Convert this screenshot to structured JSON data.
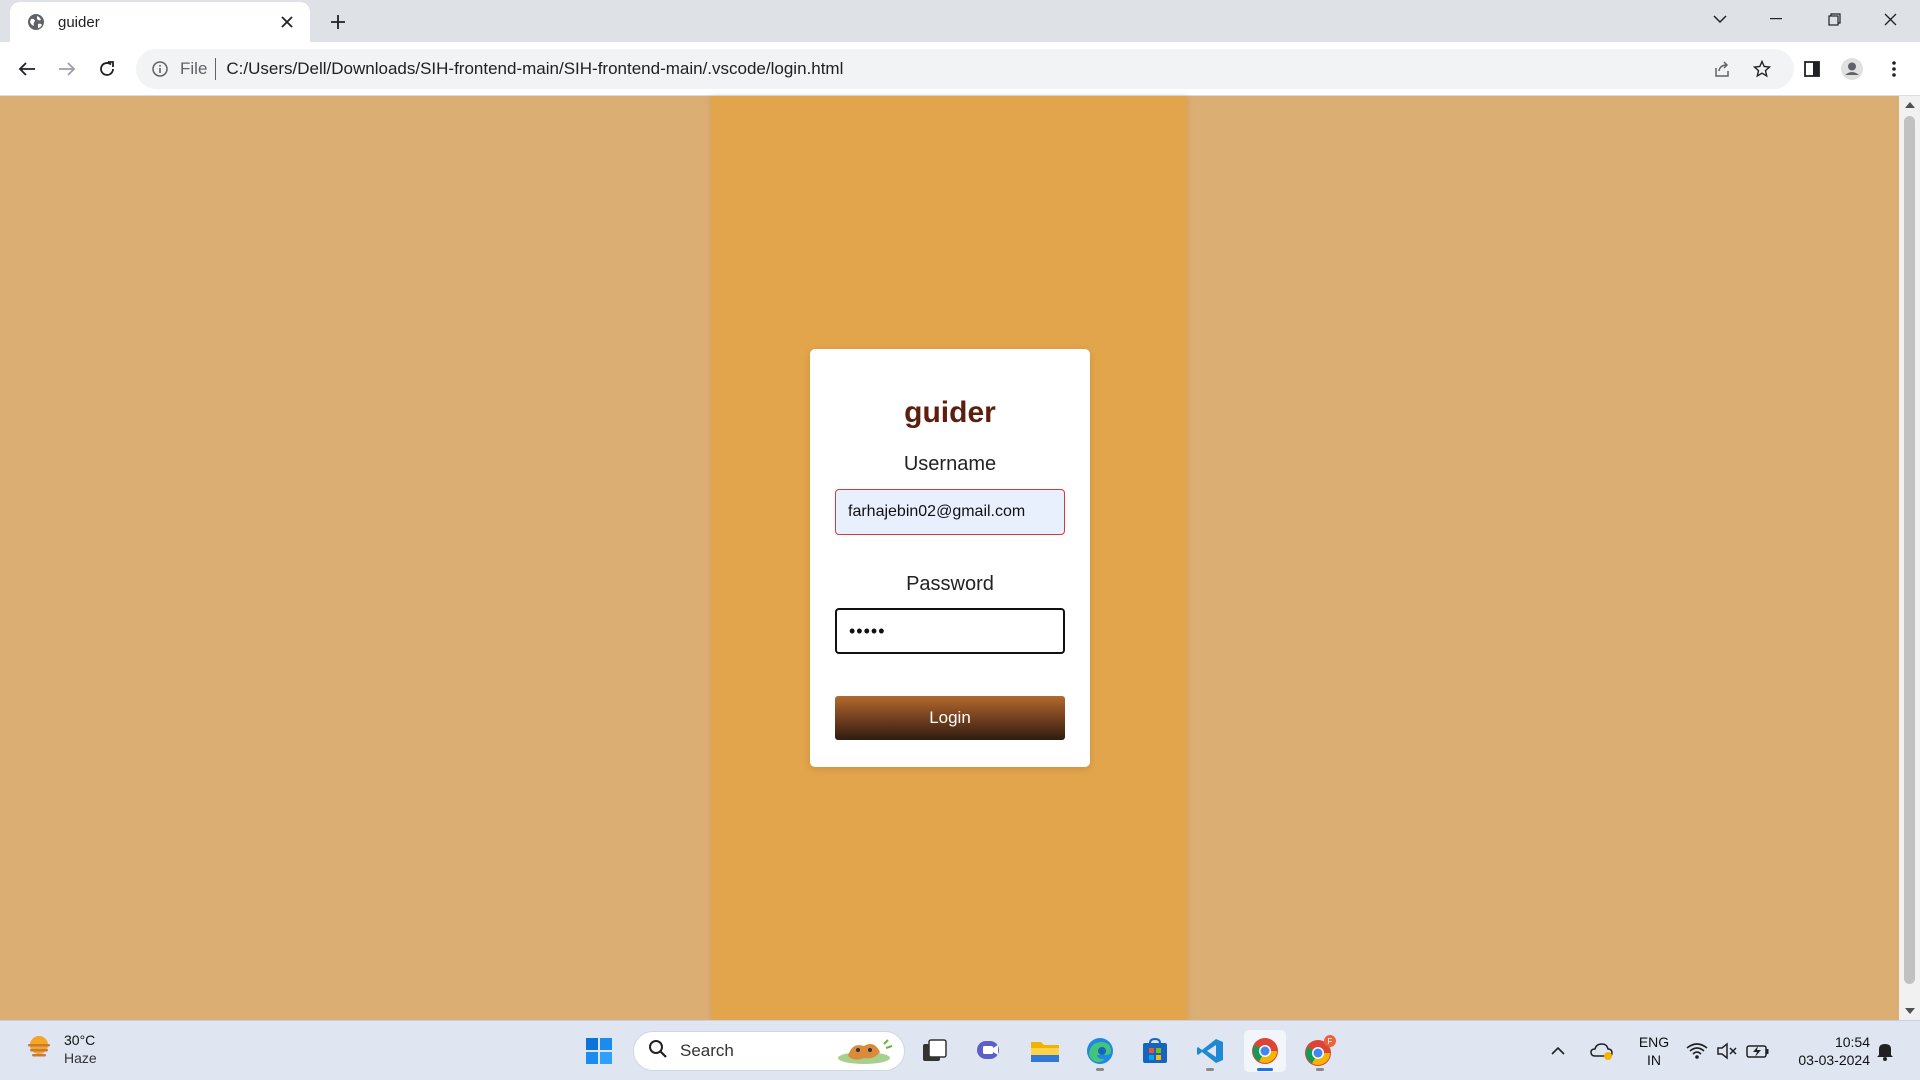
{
  "browser": {
    "tab_title": "guider",
    "url_scheme": "File",
    "url": "C:/Users/Dell/Downloads/SIH-frontend-main/SIH-frontend-main/.vscode/login.html"
  },
  "login": {
    "heading": "guider",
    "username_label": "Username",
    "username_value": "farhajebin02@gmail.com",
    "password_label": "Password",
    "password_value": "•••••",
    "login_button": "Login"
  },
  "taskbar": {
    "weather_temp": "30°C",
    "weather_condition": "Haze",
    "search_text": "Search",
    "language_line1": "ENG",
    "language_line2": "IN",
    "time": "10:54",
    "date": "03-03-2024"
  },
  "colors": {
    "page_background": "#dbae74",
    "center_strip": "#e3a54b",
    "heading": "#5c1e0e",
    "username_border": "#d23b3b"
  }
}
